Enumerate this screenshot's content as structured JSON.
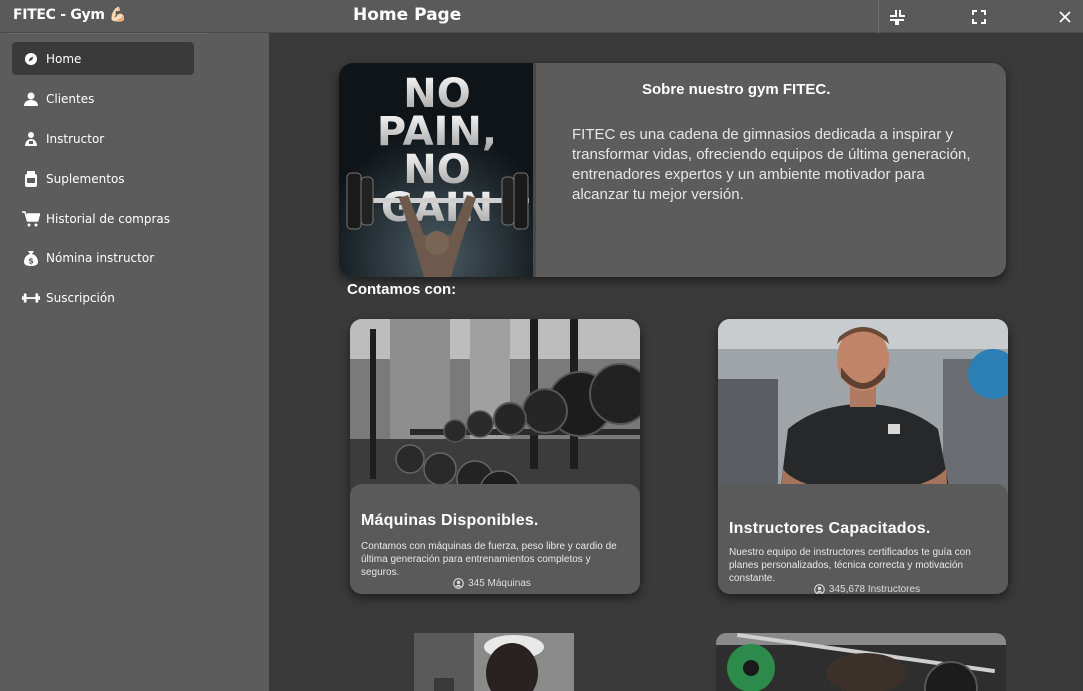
{
  "window": {
    "app_title": "FITEC - Gym 💪🏻",
    "page_title": "Home Page"
  },
  "sidebar": {
    "items": [
      {
        "label": "Home",
        "icon": "compass-icon",
        "active": true
      },
      {
        "label": "Clientes",
        "icon": "user-icon",
        "active": false
      },
      {
        "label": "Instructor",
        "icon": "instructor-icon",
        "active": false
      },
      {
        "label": "Suplementos",
        "icon": "supplement-jar-icon",
        "active": false
      },
      {
        "label": "Historial de compras",
        "icon": "cart-icon",
        "active": false
      },
      {
        "label": "Nómina instructor",
        "icon": "money-bag-icon",
        "active": false
      },
      {
        "label": "Suscripción",
        "icon": "dumbbell-icon",
        "active": false
      }
    ]
  },
  "about": {
    "image_text": "NO PAIN, NO GAIN",
    "title": "Sobre nuestro gym FITEC.",
    "text": "FITEC es una cadena de gimnasios dedicada a inspirar y transformar vidas, ofreciendo equipos de última generación, entrenadores expertos y un ambiente motivador para alcanzar tu mejor versión."
  },
  "section_title": "Contamos con:",
  "features": [
    {
      "title": "Máquinas Disponibles.",
      "description": "Contamos con máquinas de fuerza, peso libre y cardio de última generación para entrenamientos completos y seguros.",
      "count": "345 Máquinas"
    },
    {
      "title": "Instructores Capacitados.",
      "description": "Nuestro equipo de instructores certificados te guía con planes personalizados, técnica correcta y motivación constante.",
      "count": "345,678 Instructores"
    }
  ],
  "colors": {
    "titlebar": "#5a5a5a",
    "sidebar": "#5c5c5c",
    "main_bg": "#3a3a3a",
    "card": "#5c5c5c",
    "active_nav": "#3a3a3a"
  }
}
